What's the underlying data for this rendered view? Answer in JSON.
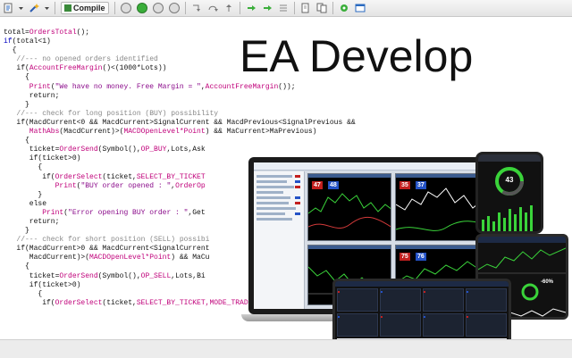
{
  "toolbar": {
    "compile_label": "Compile",
    "icons": [
      "new-file-icon",
      "dropdown-icon",
      "magic-wand-icon",
      "compile-icon",
      "stop-icon",
      "play-icon",
      "pause-icon",
      "stop-debug-icon",
      "step-into-icon",
      "step-over-icon",
      "step-out-icon",
      "go-to-icon",
      "arrow-right-icon",
      "open-icon",
      "copy-icon",
      "settings-icon",
      "window-icon"
    ]
  },
  "title": "EA Develop",
  "code_lines": [
    [
      {
        "t": "total="
      },
      {
        "t": "OrdersTotal",
        "c": "fn"
      },
      {
        "t": "();"
      }
    ],
    [
      {
        "t": "if",
        "c": "kw"
      },
      {
        "t": "(total<1)"
      }
    ],
    [
      {
        "t": "  {"
      }
    ],
    [
      {
        "t": "   //--- no opened orders identified",
        "c": "cm"
      }
    ],
    [
      {
        "t": "   if("
      },
      {
        "t": "AccountFreeMargin",
        "c": "fn"
      },
      {
        "t": "()<(1000*Lots))"
      }
    ],
    [
      {
        "t": "     {"
      }
    ],
    [
      {
        "t": "      Print",
        "c": "fn"
      },
      {
        "t": "("
      },
      {
        "t": "\"We have no money. Free Margin = \"",
        "c": "str"
      },
      {
        "t": ","
      },
      {
        "t": "AccountFreeMargin",
        "c": "fn"
      },
      {
        "t": "());"
      }
    ],
    [
      {
        "t": "      return;"
      }
    ],
    [
      {
        "t": "     }"
      }
    ],
    [
      {
        "t": "   //--- check for long position (BUY) possibility",
        "c": "cm"
      }
    ],
    [
      {
        "t": "   if(MacdCurrent<0 && MacdCurrent>SignalCurrent && MacdPrevious<SignalPrevious &&"
      }
    ],
    [
      {
        "t": "      MathAbs",
        "c": "fn"
      },
      {
        "t": "(MacdCurrent)>("
      },
      {
        "t": "MACDOpenLevel*Point",
        "c": "hl"
      },
      {
        "t": ") && MaCurrent>MaPrevious)"
      }
    ],
    [
      {
        "t": "     {"
      }
    ],
    [
      {
        "t": "      ticket="
      },
      {
        "t": "OrderSend",
        "c": "fn"
      },
      {
        "t": "(Symbol(),"
      },
      {
        "t": "OP_BUY",
        "c": "hl"
      },
      {
        "t": ",Lots,Ask"
      }
    ],
    [
      {
        "t": "      if(ticket>0)"
      }
    ],
    [
      {
        "t": "        {"
      }
    ],
    [
      {
        "t": "         if("
      },
      {
        "t": "OrderSelect",
        "c": "fn"
      },
      {
        "t": "(ticket,"
      },
      {
        "t": "SELECT_BY_TICKET",
        "c": "hl"
      }
    ],
    [
      {
        "t": "            Print",
        "c": "fn"
      },
      {
        "t": "("
      },
      {
        "t": "\"BUY order opened : \"",
        "c": "str"
      },
      {
        "t": ","
      },
      {
        "t": "OrderOp",
        "c": "fn"
      }
    ],
    [
      {
        "t": "        }"
      }
    ],
    [
      {
        "t": "      else"
      }
    ],
    [
      {
        "t": "         Print",
        "c": "fn"
      },
      {
        "t": "("
      },
      {
        "t": "\"Error opening BUY order : \"",
        "c": "str"
      },
      {
        "t": ",Get"
      }
    ],
    [
      {
        "t": "      return;"
      }
    ],
    [
      {
        "t": "     }"
      }
    ],
    [
      {
        "t": "   //--- check for short position (SELL) possibi",
        "c": "cm"
      }
    ],
    [
      {
        "t": "   if(MacdCurrent>0 && MacdCurrent<SignalCurrent"
      }
    ],
    [
      {
        "t": "      MacdCurrent)>("
      },
      {
        "t": "MACDOpenLevel*Point",
        "c": "hl"
      },
      {
        "t": ") && MaCu"
      }
    ],
    [
      {
        "t": "     {"
      }
    ],
    [
      {
        "t": "      ticket="
      },
      {
        "t": "OrderSend",
        "c": "fn"
      },
      {
        "t": "(Symbol(),"
      },
      {
        "t": "OP_SELL",
        "c": "hl"
      },
      {
        "t": ",Lots,Bi"
      }
    ],
    [
      {
        "t": "      if(ticket>0)"
      }
    ],
    [
      {
        "t": "        {"
      }
    ],
    [
      {
        "t": "         if("
      },
      {
        "t": "OrderSelect",
        "c": "fn"
      },
      {
        "t": "(ticket,"
      },
      {
        "t": "SELECT_BY_TICKET,MODE_TRADES",
        "c": "hl"
      },
      {
        "t": "))"
      }
    ]
  ],
  "terminal": {
    "phone_value": "43",
    "tablet_gauge": "-60%",
    "quotes": [
      {
        "text": "47",
        "color": "#c2201f"
      },
      {
        "text": "48",
        "color": "#2452c6"
      },
      {
        "text": "35",
        "color": "#c2201f"
      },
      {
        "text": "37",
        "color": "#2452c6"
      },
      {
        "text": "75",
        "color": "#c2201f"
      },
      {
        "text": "76",
        "color": "#2452c6"
      }
    ]
  },
  "colors": {
    "function": "#c0007a",
    "string": "#8a0a8a",
    "comment": "#888888",
    "keyword": "#0000c0"
  }
}
